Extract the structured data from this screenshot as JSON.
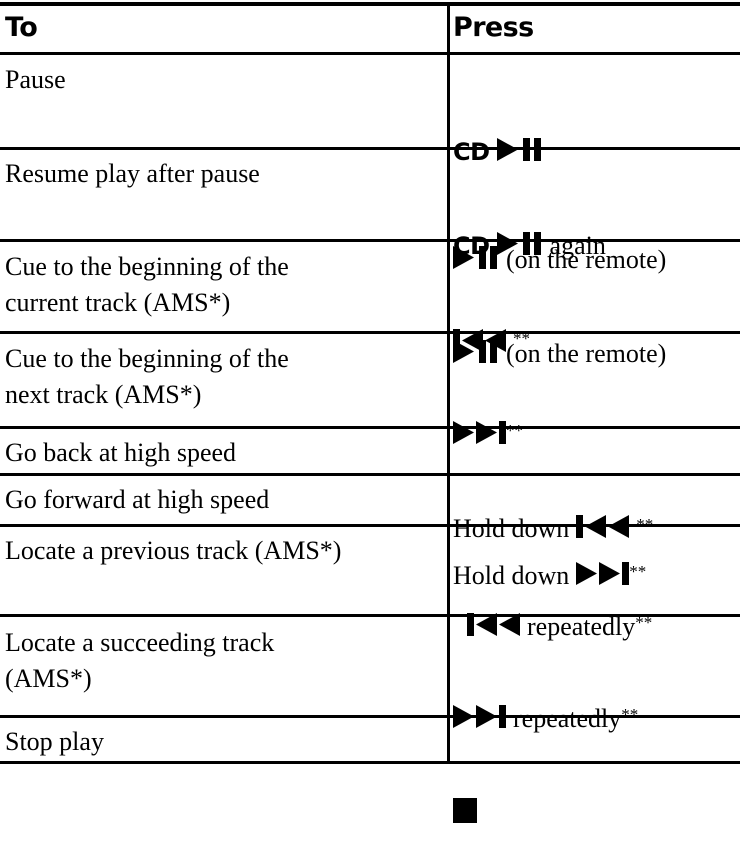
{
  "table": {
    "columns": [
      {
        "key": "to",
        "header": "To"
      },
      {
        "key": "press",
        "header": "Press"
      }
    ],
    "rows": [
      {
        "to": "Pause",
        "press_lines": [
          {
            "prefix_bold": "CD",
            "icon": "play-pause-icon",
            "suffix": ""
          },
          {
            "prefix_bold": "",
            "icon": "play-pause-icon",
            "suffix": "(on the remote)"
          }
        ]
      },
      {
        "to": "Resume play after pause",
        "press_lines": [
          {
            "prefix_bold": "CD",
            "icon": "play-pause-icon",
            "suffix": "again"
          },
          {
            "prefix_bold": "",
            "icon": "play-pause-icon",
            "suffix": "(on the remote)"
          }
        ]
      },
      {
        "to": "Cue to the beginning of the\ncurrent track (AMS*)",
        "press_lines": [
          {
            "prefix_bold": "",
            "icon": "skip-back-icon",
            "suffix": "",
            "footnote": "**"
          }
        ]
      },
      {
        "to": "Cue to the beginning of the\nnext track (AMS*)",
        "press_lines": [
          {
            "prefix_bold": "",
            "icon": "skip-forward-icon",
            "suffix": "",
            "footnote": "**"
          }
        ]
      },
      {
        "to": "Go back at high speed",
        "press_lines": [
          {
            "prefix_text": "Hold down",
            "icon": "skip-back-icon",
            "suffix": "",
            "footnote": "**"
          }
        ]
      },
      {
        "to": "Go forward at high speed",
        "press_lines": [
          {
            "prefix_text": "Hold down",
            "icon": "skip-forward-icon",
            "suffix": "",
            "footnote": "**"
          }
        ]
      },
      {
        "to": "Locate a previous track (AMS*)",
        "press_lines": [
          {
            "prefix_bold": "",
            "icon": "skip-back-icon",
            "suffix": "repeatedly",
            "footnote": "**"
          }
        ]
      },
      {
        "to": "Locate a succeeding track\n(AMS*)",
        "press_lines": [
          {
            "prefix_bold": "",
            "icon": "skip-forward-icon",
            "suffix": "repeatedly",
            "footnote": "**"
          }
        ]
      },
      {
        "to": "Stop play",
        "press_lines": [
          {
            "prefix_bold": "",
            "icon": "stop-icon",
            "suffix": ""
          }
        ]
      }
    ]
  },
  "colors": {
    "rule": "#000000",
    "text": "#000000",
    "background": "#ffffff"
  }
}
